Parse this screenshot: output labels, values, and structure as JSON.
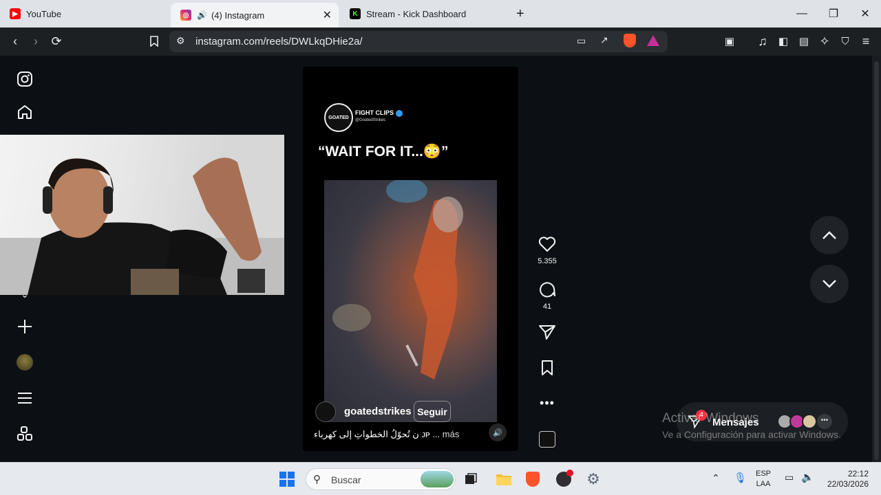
{
  "browser": {
    "tabs": [
      {
        "title": "YouTube"
      },
      {
        "title": "(4) Instagram"
      },
      {
        "title": "Stream - Kick Dashboard"
      }
    ],
    "url": "instagram.com/reels/DWLkqDHie2a/"
  },
  "reel": {
    "account_name": "FIGHT CLIPS",
    "account_handle": "@GoatedStrikes",
    "caption_title": "“WAIT FOR IT...😳”",
    "author": "goatedstrikes",
    "follow_label": "Seguir",
    "caption": "ن تُحوّلُ الخطواتِ إلى كهرباء ᴊᴘ ...",
    "more_label": "más",
    "likes": "5.355",
    "comments": "41"
  },
  "messages": {
    "label": "Mensajes",
    "badge": "4"
  },
  "watermark": {
    "line1": "Activar Windows",
    "line2": "Ve a Configuración para activar Windows."
  },
  "taskbar": {
    "search_placeholder": "Buscar",
    "lang1": "ESP",
    "lang2": "LAA",
    "time": "22:12",
    "date": "22/03/2026"
  }
}
